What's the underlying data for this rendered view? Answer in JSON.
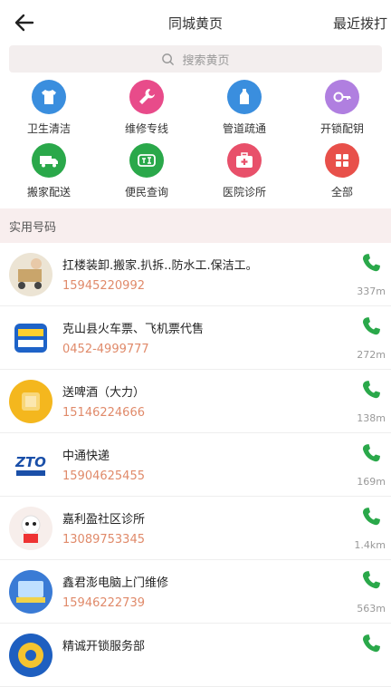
{
  "header": {
    "title": "同城黄页",
    "recent": "最近拨打"
  },
  "search": {
    "placeholder": "搜索黄页"
  },
  "categories": [
    {
      "label": "卫生清洁",
      "icon": "shirt-icon",
      "color": "#3a8ede"
    },
    {
      "label": "维修专线",
      "icon": "wrench-icon",
      "color": "#e84b8a"
    },
    {
      "label": "管道疏通",
      "icon": "bottle-icon",
      "color": "#3a8ede"
    },
    {
      "label": "开锁配钥",
      "icon": "key-icon",
      "color": "#b07fe0"
    },
    {
      "label": "搬家配送",
      "icon": "truck-icon",
      "color": "#2aa84a"
    },
    {
      "label": "便民查询",
      "icon": "convenience-icon",
      "color": "#2aa84a"
    },
    {
      "label": "医院诊所",
      "icon": "medical-kit-icon",
      "color": "#e8506a"
    },
    {
      "label": "全部",
      "icon": "grid-icon",
      "color": "#e8504a"
    }
  ],
  "section_title": "实用号码",
  "listings": [
    {
      "name": "扛楼装卸.搬家.扒拆..防水工.保洁工。",
      "phone": "15945220992",
      "distance": "337m",
      "avatar_color": "#d9c9a8"
    },
    {
      "name": "克山县火车票、飞机票代售",
      "phone": "0452-4999777",
      "distance": "272m",
      "avatar_color": "#1e63c8"
    },
    {
      "name": "送啤酒（大力）",
      "phone": "15146224666",
      "distance": "138m",
      "avatar_color": "#f4b71e"
    },
    {
      "name": "中通快递",
      "phone": "15904625455",
      "distance": "169m",
      "avatar_color": "#ffffff"
    },
    {
      "name": "嘉利盈社区诊所",
      "phone": "13089753345",
      "distance": "1.4km",
      "avatar_color": "#f4e9e6"
    },
    {
      "name": "鑫君澎电脑上门维修",
      "phone": "15946222739",
      "distance": "563m",
      "avatar_color": "#3a7bd5"
    },
    {
      "name": "精诚开锁服务部",
      "phone": "",
      "distance": "",
      "avatar_color": "#1e5fc0"
    }
  ],
  "colors": {
    "call_green": "#2aa84a",
    "phone_text": "#e08a6a"
  }
}
